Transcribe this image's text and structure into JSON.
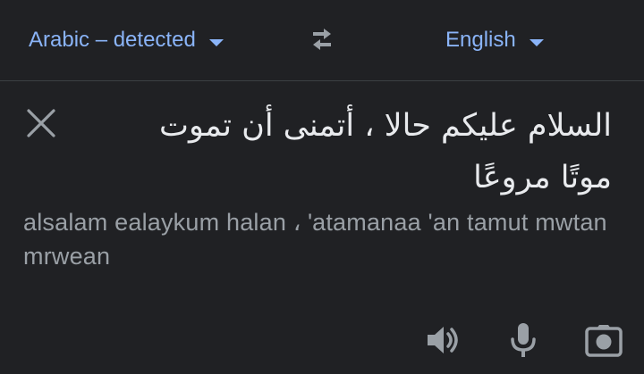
{
  "language_bar": {
    "source_language": "Arabic – detected",
    "target_language": "English",
    "swap_icon": "swap-arrows-icon",
    "accent_color": "#8ab4f8"
  },
  "input": {
    "source_text": "السلام عليكم حالا ، أتمنى أن تموت موتًا مروعًا",
    "transliteration": "alsalam ealaykum halan ، 'atamanaa 'an tamut mwtan mrwean",
    "clear_icon": "close-icon"
  },
  "toolbar": {
    "listen_icon": "speaker-icon",
    "voice_icon": "microphone-icon",
    "camera_icon": "camera-icon"
  }
}
